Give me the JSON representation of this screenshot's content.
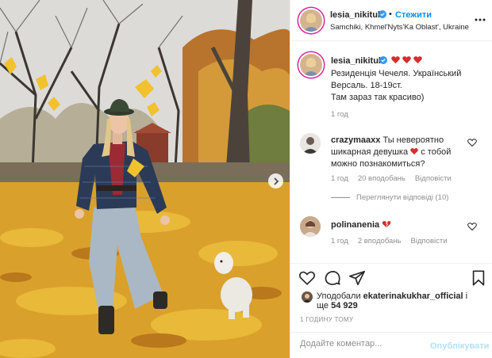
{
  "post": {
    "image_alt": "",
    "colors": {
      "accent": "#0095f6",
      "accent_disabled": "#b2dffc",
      "muted": "#8e8e8e",
      "heart": "#ed4956"
    }
  },
  "header": {
    "username": "lesia_nikituk",
    "separator": "•",
    "follow_label": "Стежити",
    "location": "Samchiki, Khmel'Nyts'Ka Oblast', Ukraine",
    "more_icon": "more-horizontal-icon"
  },
  "caption": {
    "username": "lesia_nikituk",
    "hearts": [
      "heart-icon",
      "heart-icon",
      "heart-icon"
    ],
    "lines": [
      "Резиденція Чечеля. Український",
      "Версаль. 18-19ст.",
      "Там зараз так красиво)"
    ],
    "time": "1 год"
  },
  "comments": [
    {
      "username": "crazymaaxx",
      "text_1": "Ты невероятно",
      "text_2a": "шикарная девушка",
      "text_2b": "с тобой",
      "text_3": "можно познакомиться?",
      "time": "1 год",
      "likes": "20 вподобань",
      "reply": "Відповісти",
      "view_replies": "Переглянути відповіді (10)"
    },
    {
      "username": "polinanenia",
      "time": "1 год",
      "likes": "2 вподобань",
      "reply": "Відповісти"
    }
  ],
  "likes": {
    "prefix": "Уподобали",
    "user": "ekaterinakukhar_official",
    "mid": "і",
    "line2_prefix": "ще",
    "count": "54 929"
  },
  "post_time": "1 ГОДИНУ ТОМУ",
  "comment_bar": {
    "placeholder": "Додайте коментар...",
    "publish_label": "Опублікувати"
  }
}
